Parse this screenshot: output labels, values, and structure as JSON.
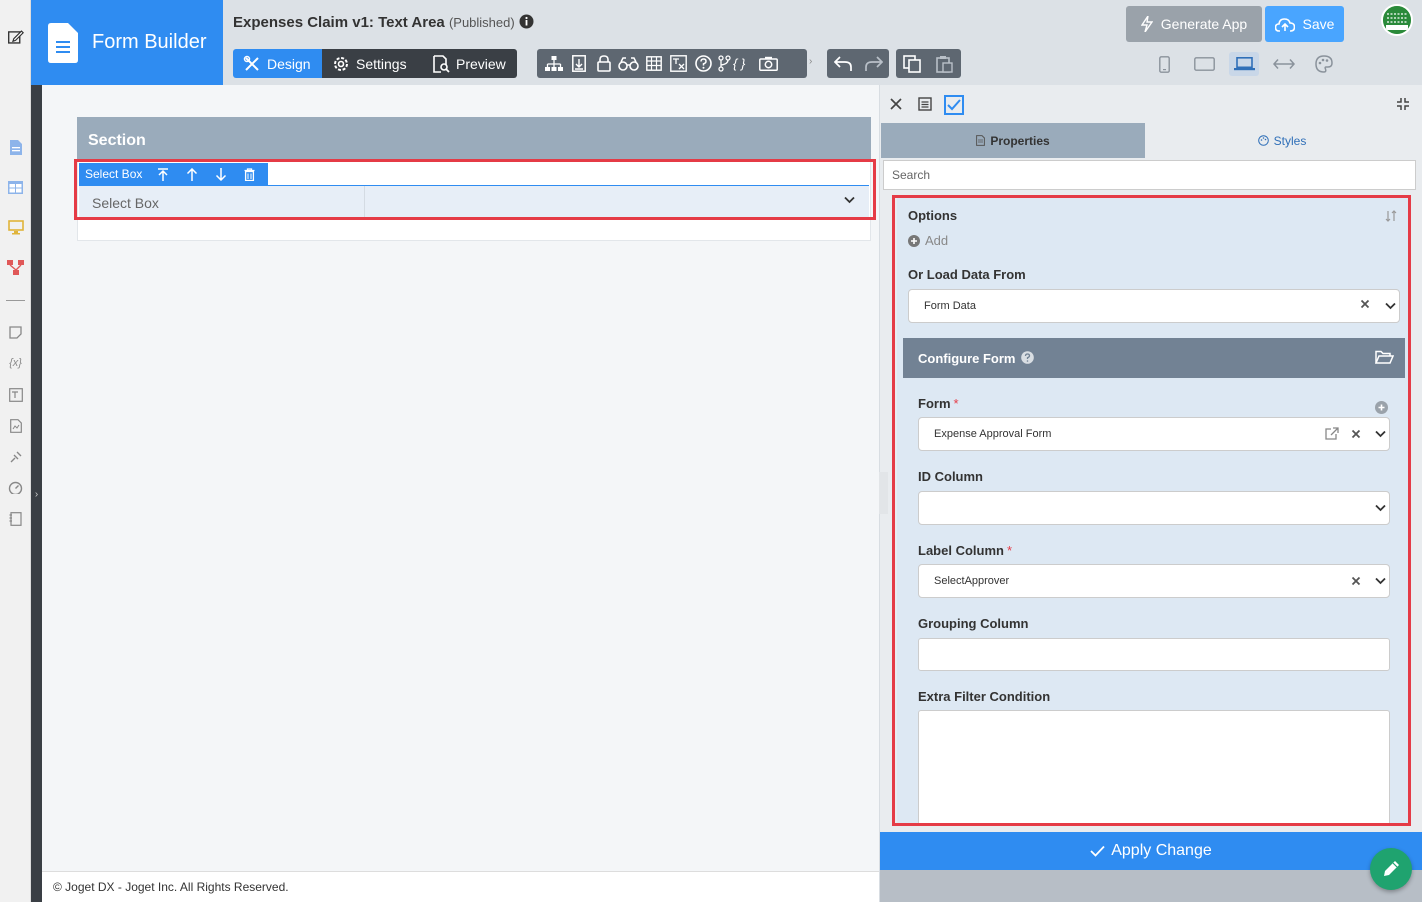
{
  "brand": {
    "title": "Form Builder"
  },
  "app": {
    "title": "Expenses Claim v1: Text Area",
    "status": "(Published)"
  },
  "modes": {
    "design": "Design",
    "settings": "Settings",
    "preview": "Preview"
  },
  "actions": {
    "generate": "Generate App",
    "save": "Save"
  },
  "canvas": {
    "section_title": "Section",
    "field_toolbar_label": "Select Box",
    "field_label": "Select Box",
    "footer": "© Joget DX - Joget Inc. All Rights Reserved."
  },
  "panel": {
    "tab_properties": "Properties",
    "tab_styles": "Styles",
    "search_placeholder": "Search",
    "options_label": "Options",
    "add_label": "Add",
    "load_from_label": "Or Load Data From",
    "load_from_value": "Form Data",
    "configure_title": "Configure Form",
    "form_label": "Form",
    "form_value": "Expense Approval Form",
    "id_column_label": "ID Column",
    "id_column_value": "",
    "label_column_label": "Label Column",
    "label_column_value": "SelectApprover",
    "grouping_column_label": "Grouping Column",
    "grouping_column_value": "",
    "extra_filter_label": "Extra Filter Condition",
    "extra_filter_value": "",
    "apply": "Apply Change"
  },
  "colors": {
    "primary": "#2f8cf1",
    "dark": "#3a3f45",
    "highlight": "#e53b46",
    "fab": "#1fa36f"
  }
}
